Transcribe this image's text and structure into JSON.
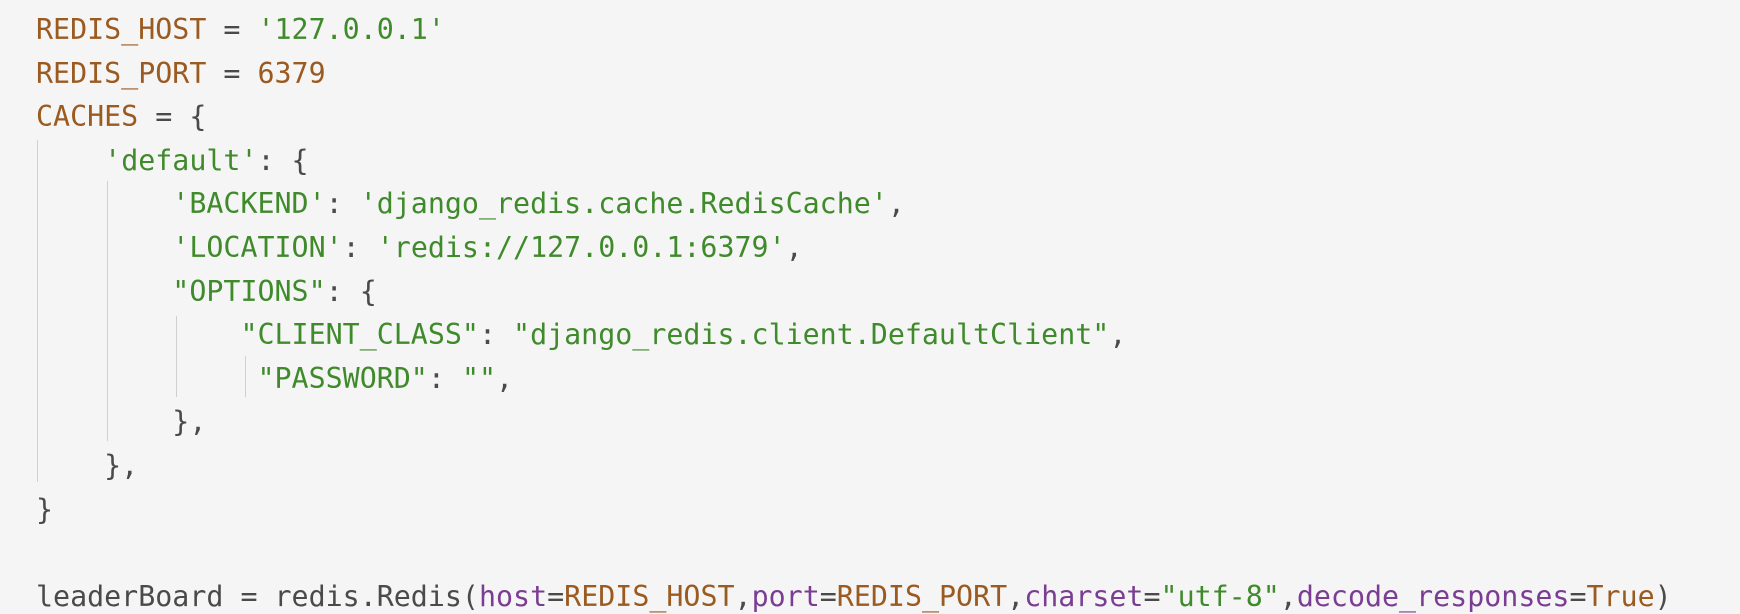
{
  "colors": {
    "background": "#f5f5f5",
    "identifier": "#9a5a20",
    "string": "#3f8a2b",
    "plain": "#4a4a4a",
    "keyword_arg": "#7a3d93",
    "guide": "#cfcfcf"
  },
  "code_lines": [
    [
      {
        "text": "REDIS_HOST",
        "kind": "identifier"
      },
      {
        "text": " = ",
        "kind": "plain"
      },
      {
        "text": "'127.0.0.1'",
        "kind": "string"
      }
    ],
    [
      {
        "text": "REDIS_PORT",
        "kind": "identifier"
      },
      {
        "text": " = ",
        "kind": "plain"
      },
      {
        "text": "6379",
        "kind": "identifier"
      }
    ],
    [
      {
        "text": "CACHES",
        "kind": "identifier"
      },
      {
        "text": " = {",
        "kind": "plain"
      }
    ],
    [
      {
        "text": "    ",
        "kind": "plain"
      },
      {
        "text": "'default'",
        "kind": "string"
      },
      {
        "text": ": {",
        "kind": "plain"
      }
    ],
    [
      {
        "text": "        ",
        "kind": "plain"
      },
      {
        "text": "'BACKEND'",
        "kind": "string"
      },
      {
        "text": ": ",
        "kind": "plain"
      },
      {
        "text": "'django_redis.cache.RedisCache'",
        "kind": "string"
      },
      {
        "text": ",",
        "kind": "plain"
      }
    ],
    [
      {
        "text": "        ",
        "kind": "plain"
      },
      {
        "text": "'LOCATION'",
        "kind": "string"
      },
      {
        "text": ": ",
        "kind": "plain"
      },
      {
        "text": "'redis://127.0.0.1:6379'",
        "kind": "string"
      },
      {
        "text": ",",
        "kind": "plain"
      }
    ],
    [
      {
        "text": "        ",
        "kind": "plain"
      },
      {
        "text": "\"OPTIONS\"",
        "kind": "string"
      },
      {
        "text": ": {",
        "kind": "plain"
      }
    ],
    [
      {
        "text": "            ",
        "kind": "plain"
      },
      {
        "text": "\"CLIENT_CLASS\"",
        "kind": "string"
      },
      {
        "text": ": ",
        "kind": "plain"
      },
      {
        "text": "\"django_redis.client.DefaultClient\"",
        "kind": "string"
      },
      {
        "text": ",",
        "kind": "plain"
      }
    ],
    [
      {
        "text": "             ",
        "kind": "plain"
      },
      {
        "text": "\"PASSWORD\"",
        "kind": "string"
      },
      {
        "text": ": ",
        "kind": "plain"
      },
      {
        "text": "\"\"",
        "kind": "string"
      },
      {
        "text": ",",
        "kind": "plain"
      }
    ],
    [
      {
        "text": "        },",
        "kind": "plain"
      }
    ],
    [
      {
        "text": "    },",
        "kind": "plain"
      }
    ],
    [
      {
        "text": "}",
        "kind": "plain"
      }
    ],
    [
      {
        "text": " ",
        "kind": "plain"
      }
    ],
    [
      {
        "text": "leaderBoard",
        "kind": "plain"
      },
      {
        "text": " = ",
        "kind": "plain"
      },
      {
        "text": "redis.Redis",
        "kind": "plain"
      },
      {
        "text": "(",
        "kind": "plain"
      },
      {
        "text": "host",
        "kind": "keyword_arg"
      },
      {
        "text": "=",
        "kind": "plain"
      },
      {
        "text": "REDIS_HOST",
        "kind": "identifier"
      },
      {
        "text": ",",
        "kind": "plain"
      },
      {
        "text": "port",
        "kind": "keyword_arg"
      },
      {
        "text": "=",
        "kind": "plain"
      },
      {
        "text": "REDIS_PORT",
        "kind": "identifier"
      },
      {
        "text": ",",
        "kind": "plain"
      },
      {
        "text": "charset",
        "kind": "keyword_arg"
      },
      {
        "text": "=",
        "kind": "plain"
      },
      {
        "text": "\"utf-8\"",
        "kind": "string"
      },
      {
        "text": ",",
        "kind": "plain"
      },
      {
        "text": "decode_responses",
        "kind": "keyword_arg"
      },
      {
        "text": "=",
        "kind": "plain"
      },
      {
        "text": "True",
        "kind": "identifier"
      },
      {
        "text": ")",
        "kind": "plain"
      }
    ]
  ]
}
